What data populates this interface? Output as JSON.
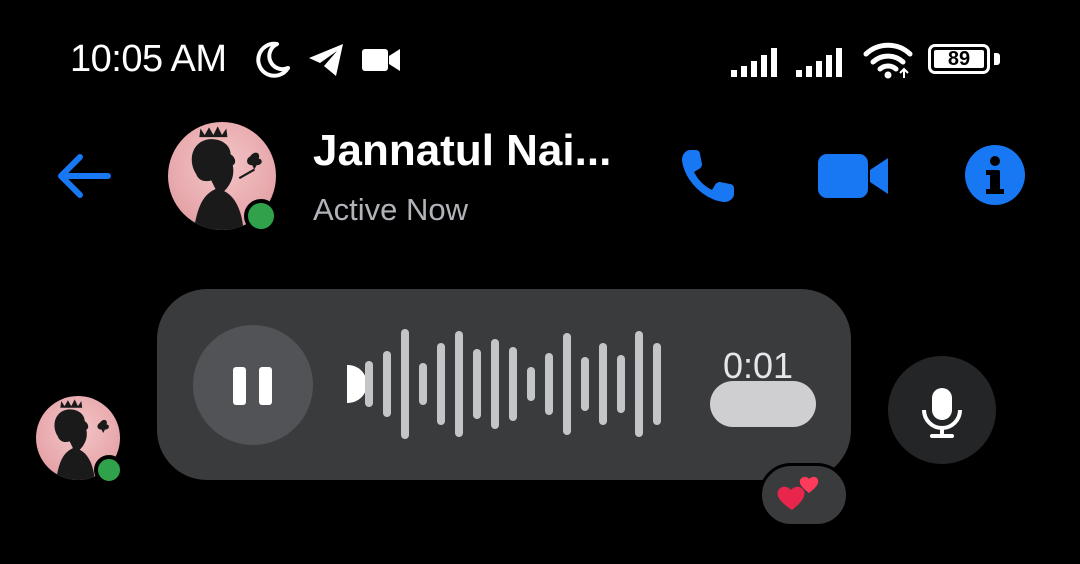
{
  "status_bar": {
    "time": "10:05 AM",
    "left_icons": [
      "moon-icon",
      "telegram-icon",
      "video-camera-icon"
    ],
    "right_icons": [
      "signal-icon",
      "signal-icon",
      "wifi-icon"
    ],
    "battery_level": "89"
  },
  "header": {
    "back_icon": "arrow-left-icon",
    "contact_name": "Jannatul Nai...",
    "status": "Active Now",
    "actions": [
      "phone-icon",
      "video-call-icon",
      "info-icon"
    ],
    "accent_color": "#1877f2",
    "online_color": "#31a24c"
  },
  "voice_message": {
    "control": "pause-icon",
    "duration": "0:01",
    "reaction": "two-hearts-emoji"
  },
  "composer": {
    "mic_icon": "microphone-icon"
  }
}
